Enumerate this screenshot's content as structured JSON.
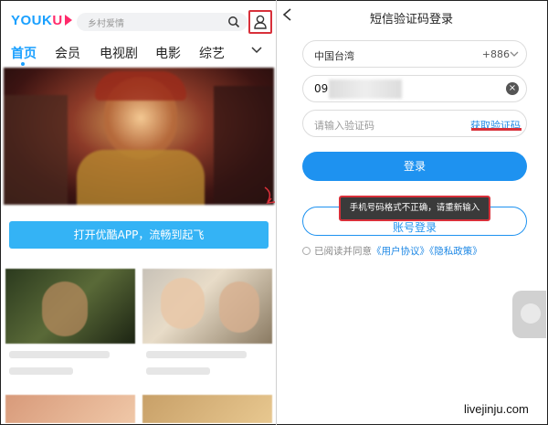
{
  "left_app": {
    "logo": "YOUKU",
    "search_placeholder": "乡村爱情",
    "tabs": [
      "首页",
      "会员",
      "电视剧",
      "电影",
      "综艺"
    ],
    "open_app_button": "打开优酷APP，流畅到起飞"
  },
  "login_page": {
    "title": "短信验证码登录",
    "region": "中国台湾",
    "country_code": "+886",
    "phone_value": "09",
    "code_placeholder": "请输入验证码",
    "get_code_label": "获取验证码",
    "login_button": "登录",
    "alt_login_button": "账号登录",
    "toast": "手机号码格式不正确，请重新输入",
    "agree_prefix": "已阅读并同意",
    "user_agreement": "《用户协议》",
    "privacy_policy": "《隐私政策》"
  },
  "watermark": "livejinju.com",
  "colors": {
    "accent": "#1e92f0",
    "highlight": "#d8303a",
    "brand_blue": "#1aa0ff",
    "brand_pink": "#ff2a6b"
  }
}
